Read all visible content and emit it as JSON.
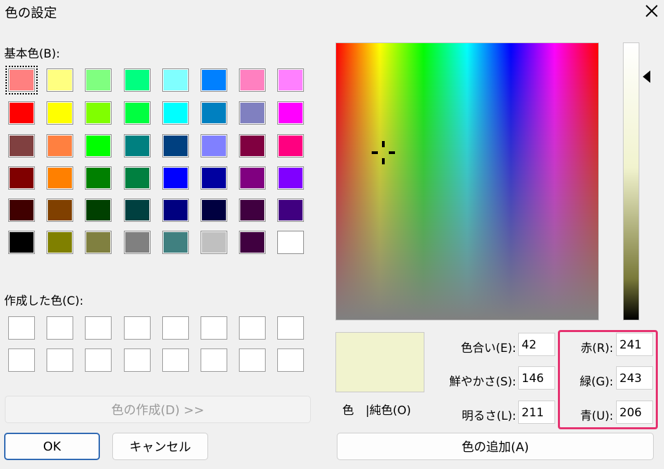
{
  "window": {
    "title": "色の設定"
  },
  "basic_colors": {
    "label": "基本色(B):",
    "colors": [
      "#ff8080",
      "#ffff80",
      "#80ff80",
      "#00ff80",
      "#80ffff",
      "#0080ff",
      "#ff80c0",
      "#ff80ff",
      "#ff0000",
      "#ffff00",
      "#80ff00",
      "#00ff40",
      "#00ffff",
      "#0080c0",
      "#8080c0",
      "#ff00ff",
      "#804040",
      "#ff8040",
      "#00ff00",
      "#008080",
      "#004080",
      "#8080ff",
      "#800040",
      "#ff0080",
      "#800000",
      "#ff8000",
      "#008000",
      "#008040",
      "#0000ff",
      "#0000a0",
      "#800080",
      "#8000ff",
      "#400000",
      "#804000",
      "#004000",
      "#004040",
      "#000080",
      "#000040",
      "#400040",
      "#400080",
      "#000000",
      "#808000",
      "#808040",
      "#808080",
      "#408080",
      "#c0c0c0",
      "#400040",
      "#ffffff"
    ]
  },
  "custom_colors": {
    "label": "作成した色(C):"
  },
  "buttons": {
    "define": "色の作成(D) >>",
    "ok": "OK",
    "cancel": "キャンセル",
    "add": "色の追加(A)"
  },
  "preview": {
    "label": "色　|純色(O)",
    "color": "#f1f3ce"
  },
  "fields": {
    "hue": {
      "label": "色合い(E):",
      "value": "42"
    },
    "sat": {
      "label": "鮮やかさ(S):",
      "value": "146"
    },
    "lum": {
      "label": "明るさ(L):",
      "value": "211"
    },
    "red": {
      "label": "赤(R):",
      "value": "241"
    },
    "green": {
      "label": "緑(G):",
      "value": "243"
    },
    "blue": {
      "label": "青(U):",
      "value": "206"
    }
  },
  "colors": {
    "highlight": "#e5316f",
    "focus": "#2f69b3"
  }
}
